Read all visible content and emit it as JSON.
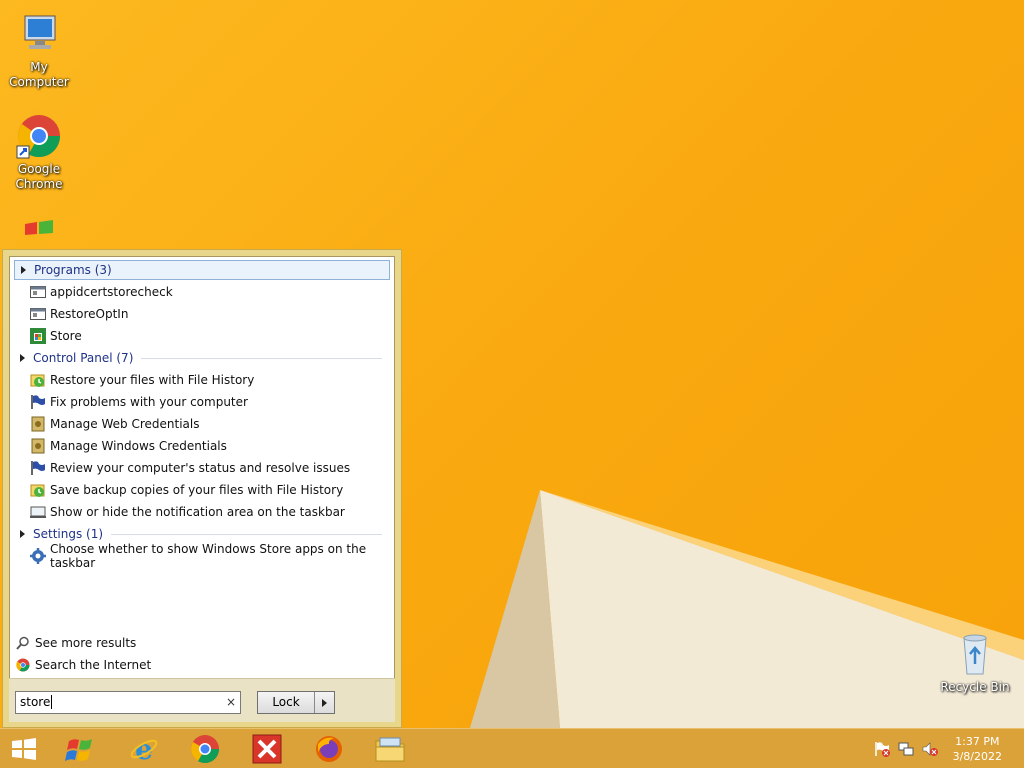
{
  "desktop": {
    "icons": [
      {
        "label": "My Computer"
      },
      {
        "label": "Google Chrome"
      },
      {
        "label": "Recycle Bin"
      }
    ]
  },
  "start_menu": {
    "groups": [
      {
        "label": "Programs (3)",
        "items": [
          "appidcertstorecheck",
          "RestoreOptIn",
          "Store"
        ]
      },
      {
        "label": "Control Panel (7)",
        "items": [
          "Restore your files with File History",
          "Fix problems with your computer",
          "Manage Web Credentials",
          "Manage Windows Credentials",
          "Review your computer's status and resolve issues",
          "Save backup copies of your files with File History",
          "Show or hide the notification area on the taskbar"
        ]
      },
      {
        "label": "Settings (1)",
        "items": [
          "Choose whether to show Windows Store apps on the taskbar"
        ]
      }
    ],
    "see_more": "See more results",
    "search_internet": "Search the Internet",
    "search_value": "store",
    "clear_glyph": "×",
    "lock_label": "Lock"
  },
  "taskbar": {
    "time": "1:37 PM",
    "date": "3/8/2022"
  },
  "colors": {
    "wallpaper": "#f9a80e",
    "taskbar": "#dba23a",
    "link_blue": "#1e3287"
  }
}
